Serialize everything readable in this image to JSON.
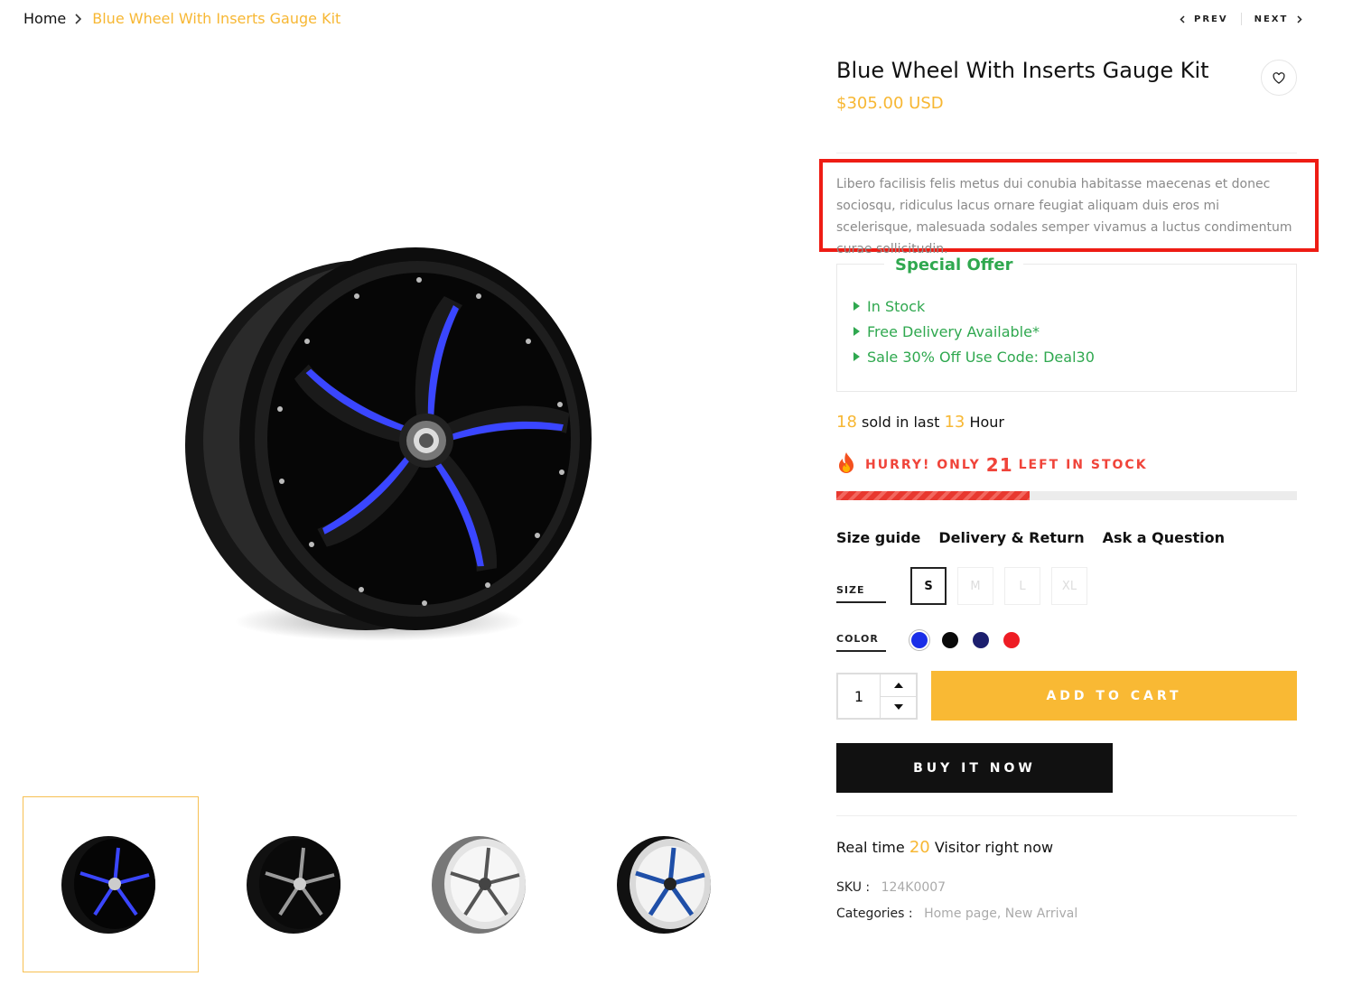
{
  "breadcrumb": {
    "home": "Home",
    "current": "Blue Wheel With Inserts Gauge Kit"
  },
  "pager": {
    "prev": "PREV",
    "next": "NEXT"
  },
  "product": {
    "title": "Blue Wheel With Inserts Gauge Kit",
    "price": "$305.00 USD",
    "description": "Libero facilisis felis metus dui conubia habitasse maecenas et donec sociosqu, ridiculus lacus ornare feugiat aliquam duis eros mi scelerisque, malesuada sodales semper vivamus a luctus condimentum curae sollicitudin."
  },
  "offer": {
    "title": "Special Offer",
    "items": [
      "In Stock",
      "Free Delivery Available*",
      "Sale 30% Off Use Code: Deal30"
    ]
  },
  "sold": {
    "count": "18",
    "mid": "sold in last",
    "hours": "13",
    "unit": "Hour"
  },
  "stock": {
    "prefix": "HURRY! ONLY",
    "count": "21",
    "suffix": "LEFT IN STOCK",
    "fill_fraction": 0.42
  },
  "links": [
    "Size guide",
    "Delivery & Return",
    "Ask a Question"
  ],
  "size": {
    "label": "SIZE",
    "options": [
      "S",
      "M",
      "L",
      "XL"
    ],
    "selected": "S"
  },
  "color": {
    "label": "COLOR",
    "swatches": [
      "#1a2ee8",
      "#0a0a0a",
      "#1c1f6e",
      "#ee1c24"
    ],
    "selected": 0
  },
  "quantity": "1",
  "buttons": {
    "add_to_cart": "ADD TO CART",
    "buy_now": "BUY IT NOW"
  },
  "visitors": {
    "prefix": "Real time",
    "count": "20",
    "suffix": "Visitor right now"
  },
  "sku": {
    "label": "SKU :",
    "value": "124K0007"
  },
  "categories": {
    "label": "Categories :",
    "values": [
      "Home page",
      "New Arrival"
    ]
  },
  "colors": {
    "accent": "#f7b733",
    "green": "#2fa84f",
    "red": "#f0443a",
    "highlight": "#ee1c14"
  }
}
